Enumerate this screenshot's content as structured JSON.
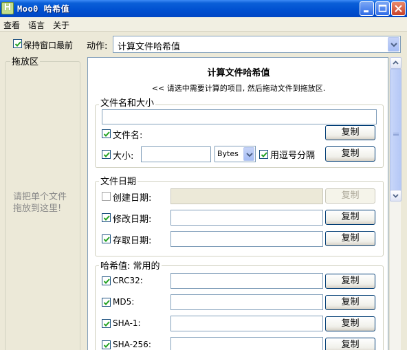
{
  "window": {
    "title": "Moo0 哈希值",
    "icon_letter": "H"
  },
  "menu": {
    "items": [
      "查看",
      "语言",
      "关于"
    ]
  },
  "topbar": {
    "keep_top_label": "保持窗口最前",
    "keep_top_checked": true,
    "action_label": "动作:",
    "action_value": "计算文件哈希值"
  },
  "dropzone": {
    "title": "拖放区",
    "hint": "请把单个文件拖放到这里!"
  },
  "panel": {
    "title": "计算文件哈希值",
    "subtitle": "<< 请选中需要计算的项目, 然后拖动文件到拖放区."
  },
  "group_name_size": {
    "title": "文件名和大小",
    "filename_label": "文件名:",
    "filename_checked": true,
    "size_label": "大小:",
    "size_checked": true,
    "size_unit": "Bytes",
    "comma_label": "用逗号分隔",
    "comma_checked": true
  },
  "group_dates": {
    "title": "文件日期",
    "created_label": "创建日期:",
    "created_checked": false,
    "modified_label": "修改日期:",
    "modified_checked": true,
    "accessed_label": "存取日期:",
    "accessed_checked": true
  },
  "group_hash": {
    "title": "哈希值: 常用的",
    "crc32_label": "CRC32:",
    "md5_label": "MD5:",
    "sha1_label": "SHA-1:",
    "sha256_label": "SHA-256:"
  },
  "copy_label": "复制"
}
